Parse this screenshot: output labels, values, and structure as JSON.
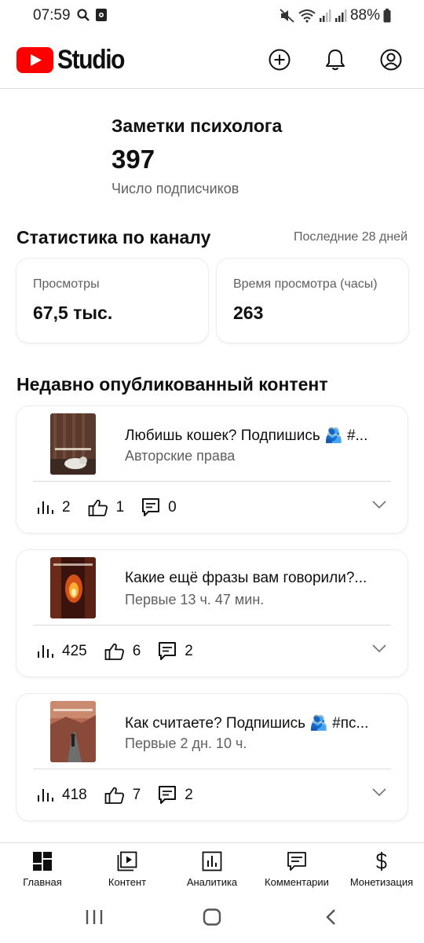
{
  "status_bar": {
    "time": "07:59",
    "battery": "88%"
  },
  "app": {
    "logo_text": "Studio",
    "brand_color": "#ff0000",
    "actions": [
      "create-icon",
      "bell-icon",
      "account-icon"
    ]
  },
  "channel": {
    "name": "Заметки психолога",
    "subscribers": "397",
    "subscribers_label": "Число подписчиков"
  },
  "stats": {
    "title": "Статистика по каналу",
    "period": "Последние 28 дней",
    "cards": [
      {
        "label": "Просмотры",
        "value": "67,5 тыс."
      },
      {
        "label": "Время просмотра (часы)",
        "value": "263"
      }
    ]
  },
  "recent": {
    "title": "Недавно опубликованный контент",
    "videos": [
      {
        "title": "Любишь кошек? Подпишись 🫂 #...",
        "subtitle": "Авторские права",
        "views": "2",
        "likes": "1",
        "comments": "0"
      },
      {
        "title": "Какие ещё фразы вам говорили?...",
        "subtitle": "Первые 13 ч. 47 мин.",
        "views": "425",
        "likes": "6",
        "comments": "2"
      },
      {
        "title": "Как считаете? Подпишись 🫂 #пс...",
        "subtitle": "Первые 2 дн. 10 ч.",
        "views": "418",
        "likes": "7",
        "comments": "2"
      }
    ]
  },
  "bottom_nav": [
    {
      "label": "Главная",
      "icon": "dashboard-icon"
    },
    {
      "label": "Контент",
      "icon": "content-icon"
    },
    {
      "label": "Аналитика",
      "icon": "analytics-icon"
    },
    {
      "label": "Комментарии",
      "icon": "comments-icon"
    },
    {
      "label": "Монетизация",
      "icon": "dollar-icon"
    }
  ]
}
